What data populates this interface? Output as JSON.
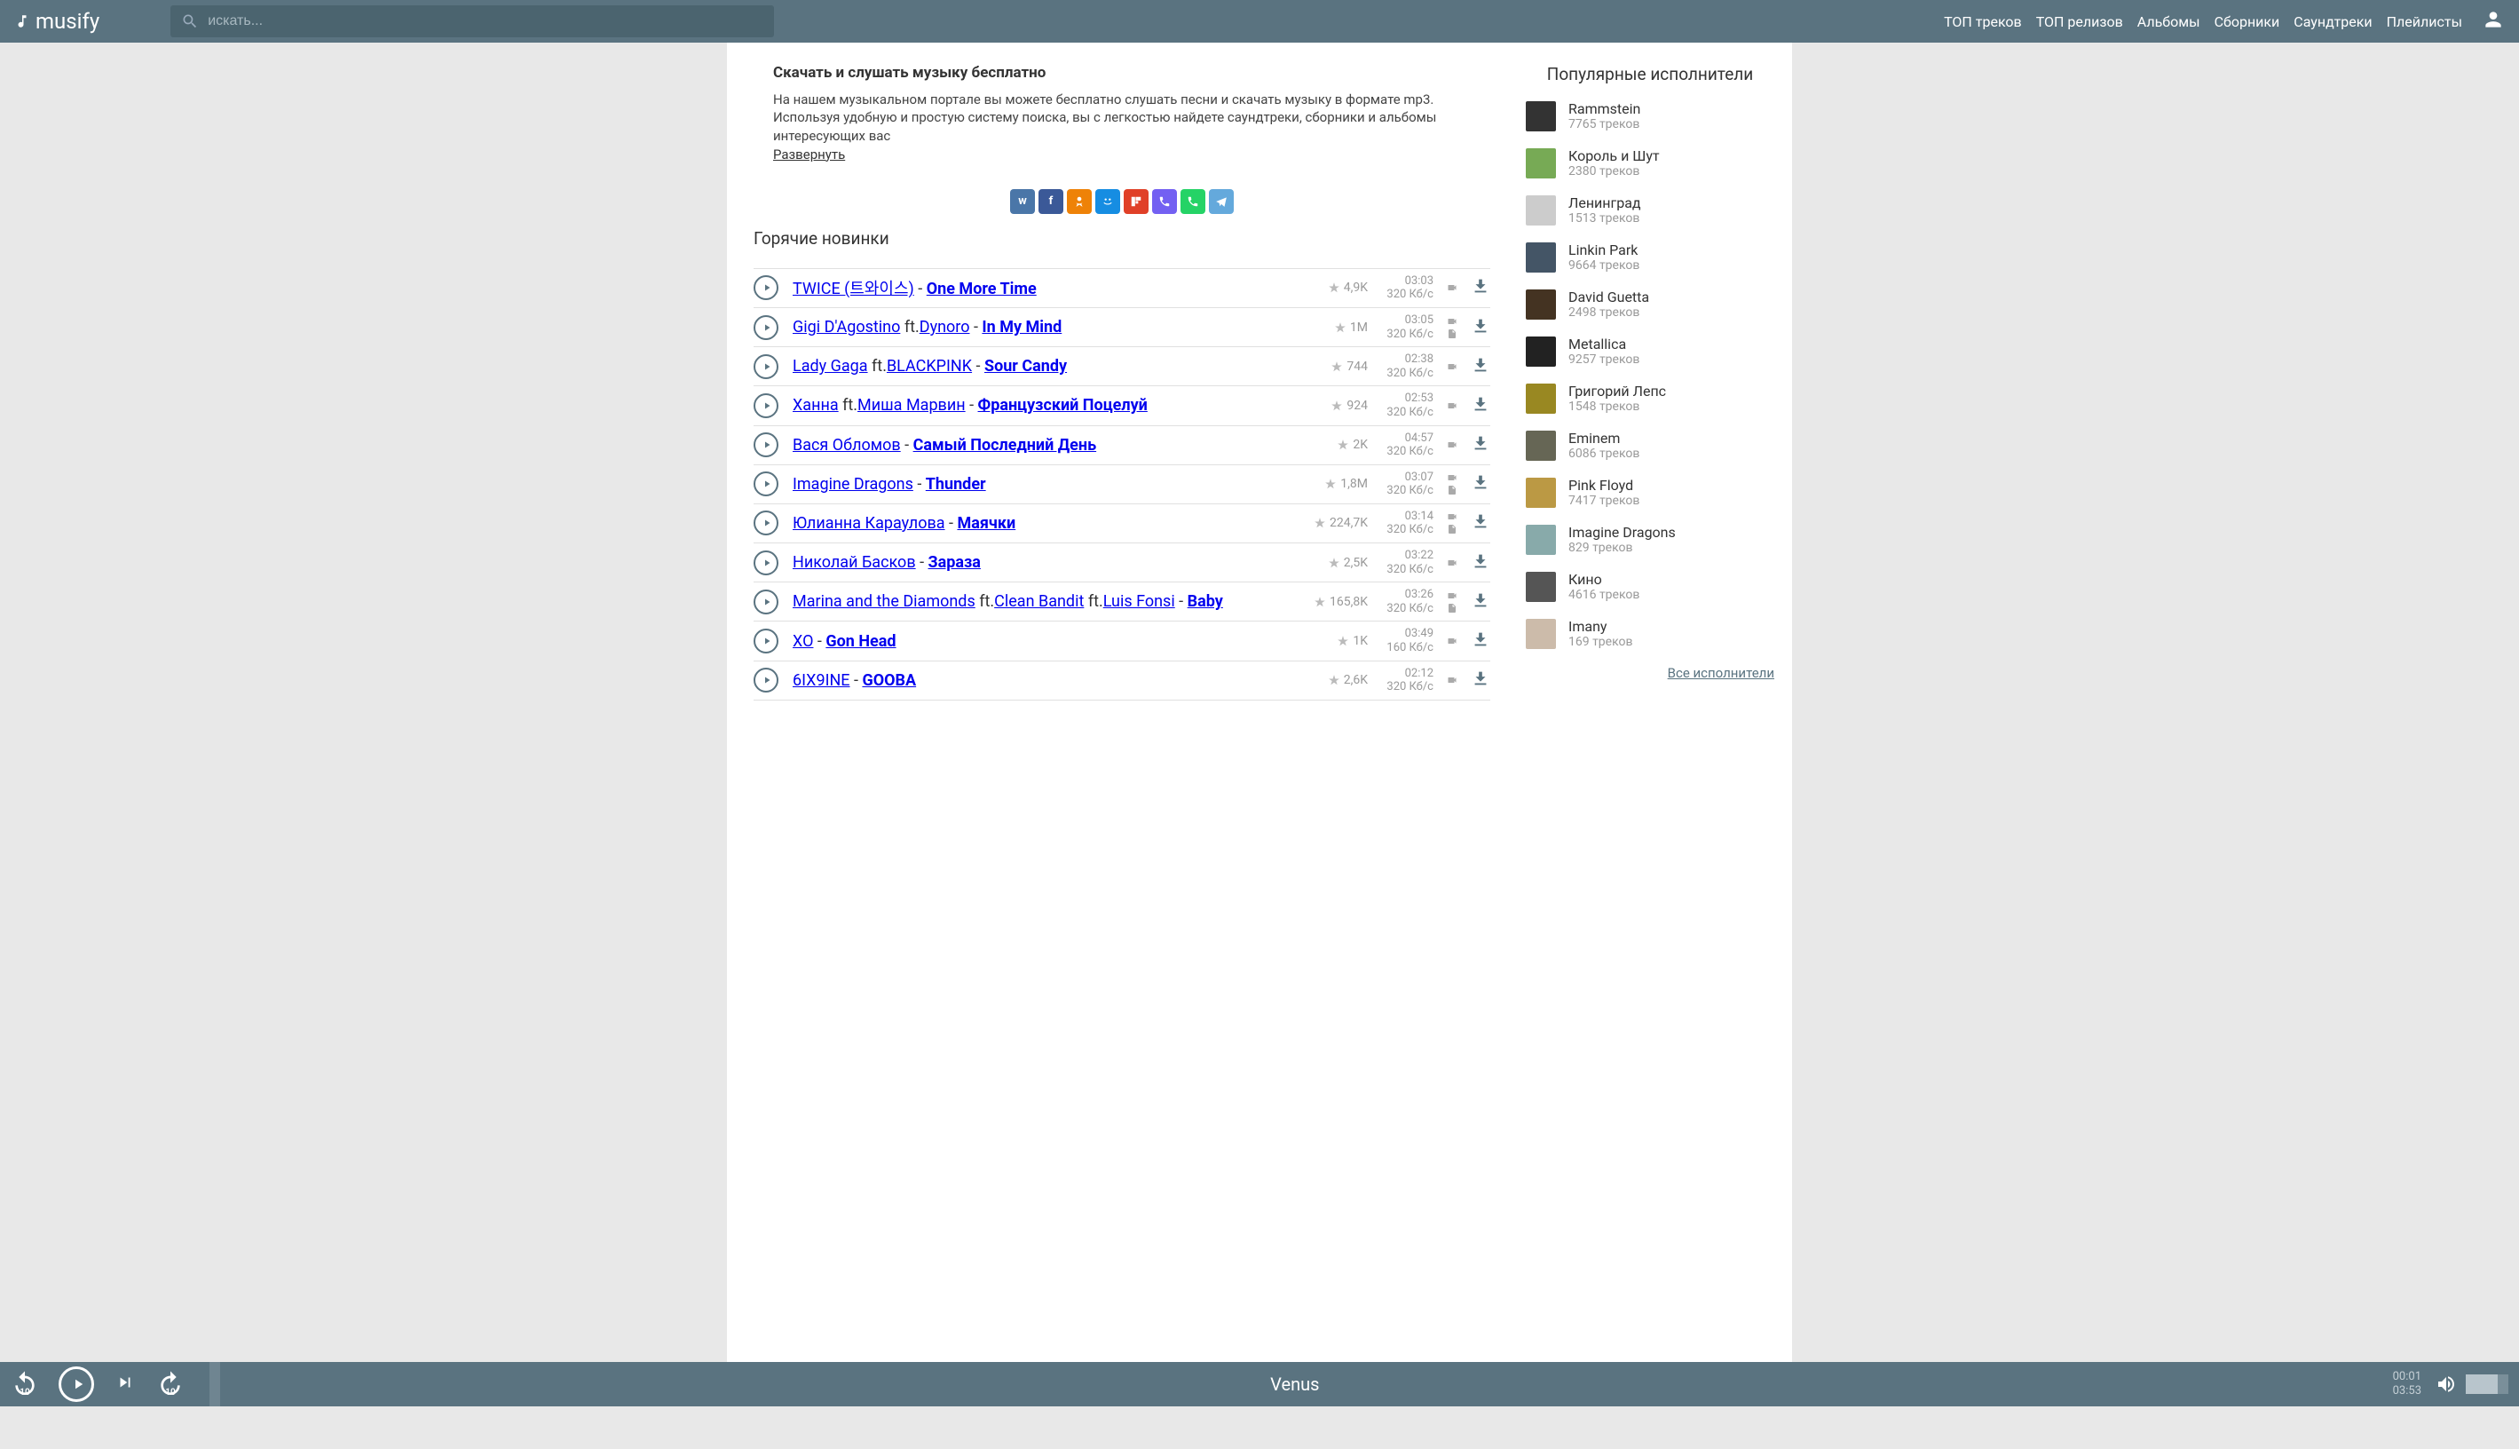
{
  "brand": "musify",
  "search": {
    "placeholder": "искать..."
  },
  "nav": [
    "ТОП треков",
    "ТОП релизов",
    "Альбомы",
    "Сборники",
    "Саундтреки",
    "Плейлисты"
  ],
  "intro": {
    "title": "Скачать и слушать музыку бесплатно",
    "text": "На нашем музыкальном портале вы можете бесплатно слушать песни и скачать музыку в формате mp3. Используя удобную и простую систему поиска, вы с легкостью найдете саундтреки, сборники и альбомы интересующих вас",
    "expand": "Развернуть"
  },
  "hot_title": "Горячие новинки",
  "tracks": [
    {
      "artist": "TWICE (트와이스)",
      "feat": [],
      "title": "One More Time",
      "rating": "4,9K",
      "time": "03:03",
      "bitrate": "320 Кб/с",
      "hasVideo": true,
      "hasLyrics": false
    },
    {
      "artist": "Gigi D'Agostino",
      "feat": [
        "Dynoro"
      ],
      "title": "In My Mind",
      "rating": "1М",
      "time": "03:05",
      "bitrate": "320 Кб/с",
      "hasVideo": true,
      "hasLyrics": true
    },
    {
      "artist": "Lady Gaga",
      "feat": [
        "BLACKPINK"
      ],
      "title": "Sour Candy",
      "rating": "744",
      "time": "02:38",
      "bitrate": "320 Кб/с",
      "hasVideo": true,
      "hasLyrics": false
    },
    {
      "artist": "Ханна",
      "feat": [
        "Миша Марвин"
      ],
      "title": "Французский Поцелуй",
      "rating": "924",
      "time": "02:53",
      "bitrate": "320 Кб/с",
      "hasVideo": true,
      "hasLyrics": false
    },
    {
      "artist": "Вася Обломов",
      "feat": [],
      "title": "Самый Последний День",
      "rating": "2K",
      "time": "04:57",
      "bitrate": "320 Кб/с",
      "hasVideo": true,
      "hasLyrics": false
    },
    {
      "artist": "Imagine Dragons",
      "feat": [],
      "title": "Thunder",
      "rating": "1,8M",
      "time": "03:07",
      "bitrate": "320 Кб/с",
      "hasVideo": true,
      "hasLyrics": true
    },
    {
      "artist": "Юлианна Караулова",
      "feat": [],
      "title": "Маячки",
      "rating": "224,7K",
      "time": "03:14",
      "bitrate": "320 Кб/с",
      "hasVideo": true,
      "hasLyrics": true
    },
    {
      "artist": "Николай Басков",
      "feat": [],
      "title": "Зараза",
      "rating": "2,5K",
      "time": "03:22",
      "bitrate": "320 Кб/с",
      "hasVideo": true,
      "hasLyrics": false
    },
    {
      "artist": "Marina and the Diamonds",
      "feat": [
        "Clean Bandit",
        "Luis Fonsi"
      ],
      "title": "Baby",
      "rating": "165,8K",
      "time": "03:26",
      "bitrate": "320 Кб/с",
      "hasVideo": true,
      "hasLyrics": true
    },
    {
      "artist": "XO",
      "feat": [],
      "title": "Gon Head",
      "rating": "1K",
      "time": "03:49",
      "bitrate": "160 Кб/с",
      "hasVideo": true,
      "hasLyrics": false
    },
    {
      "artist": "6IX9INE",
      "feat": [],
      "title": "GOOBA",
      "rating": "2,6K",
      "time": "02:12",
      "bitrate": "320 Кб/с",
      "hasVideo": true,
      "hasLyrics": false
    }
  ],
  "sidebar_title": "Популярные исполнители",
  "artists": [
    {
      "name": "Rammstein",
      "count": "7765 треков"
    },
    {
      "name": "Король и Шут",
      "count": "2380 треков"
    },
    {
      "name": "Ленинград",
      "count": "1513 треков"
    },
    {
      "name": "Linkin Park",
      "count": "9664 треков"
    },
    {
      "name": "David Guetta",
      "count": "2498 треков"
    },
    {
      "name": "Metallica",
      "count": "9257 треков"
    },
    {
      "name": "Григорий Лепс",
      "count": "1548 треков"
    },
    {
      "name": "Eminem",
      "count": "6086 треков"
    },
    {
      "name": "Pink Floyd",
      "count": "7417 треков"
    },
    {
      "name": "Imagine Dragons",
      "count": "829 треков"
    },
    {
      "name": "Кино",
      "count": "4616 треков"
    },
    {
      "name": "Imany",
      "count": "169 треков"
    }
  ],
  "all_artists": "Все исполнители",
  "player": {
    "now_playing": "Venus",
    "elapsed": "00:01",
    "total": "03:53",
    "skip_amount": "10"
  },
  "ft_label": "ft."
}
